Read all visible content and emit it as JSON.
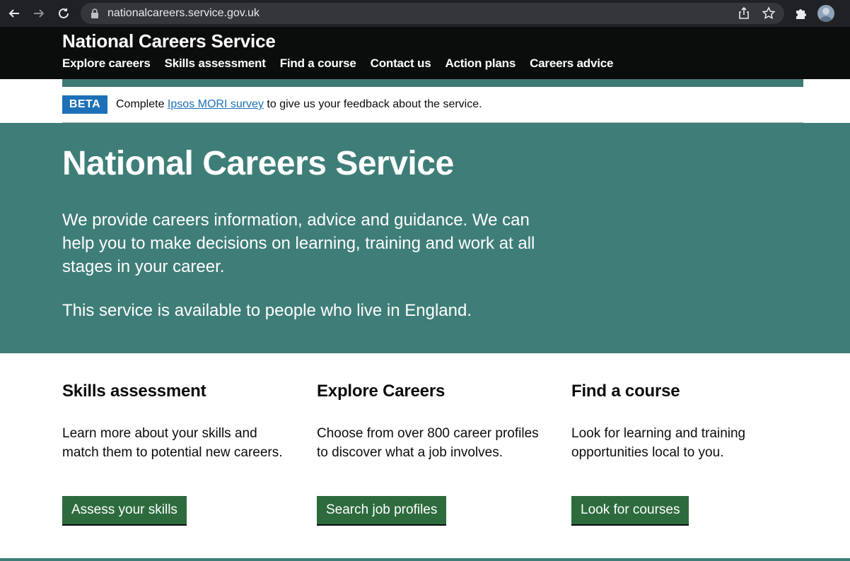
{
  "browser": {
    "url": "nationalcareers.service.gov.uk"
  },
  "header": {
    "title": "National Careers Service",
    "nav": [
      {
        "label": "Explore careers"
      },
      {
        "label": "Skills assessment"
      },
      {
        "label": "Find a course"
      },
      {
        "label": "Contact us"
      },
      {
        "label": "Action plans"
      },
      {
        "label": "Careers advice"
      }
    ]
  },
  "beta": {
    "tag": "BETA",
    "prefix": "Complete ",
    "link": "Ipsos MORI survey",
    "suffix": " to give us your feedback about the service."
  },
  "hero": {
    "title": "National Careers Service",
    "lead": "We provide careers information, advice and guidance. We can help you to make decisions on learning, training and work at all stages in your career.",
    "note": "This service is available to people who live in England."
  },
  "cards": [
    {
      "title": "Skills assessment",
      "body": "Learn more about your skills and match them to potential new careers.",
      "button": "Assess your skills"
    },
    {
      "title": "Explore Careers",
      "body": "Choose from over 800 career profiles to discover what a job involves.",
      "button": "Search job profiles"
    },
    {
      "title": "Find a course",
      "body": "Look for learning and training opportunities local to you.",
      "button": "Look for courses"
    }
  ],
  "colors": {
    "header_bg": "#0b0c0c",
    "hero_bg": "#3f7e78",
    "button_bg": "#2d6b3d",
    "beta_tag": "#1d70b8"
  }
}
